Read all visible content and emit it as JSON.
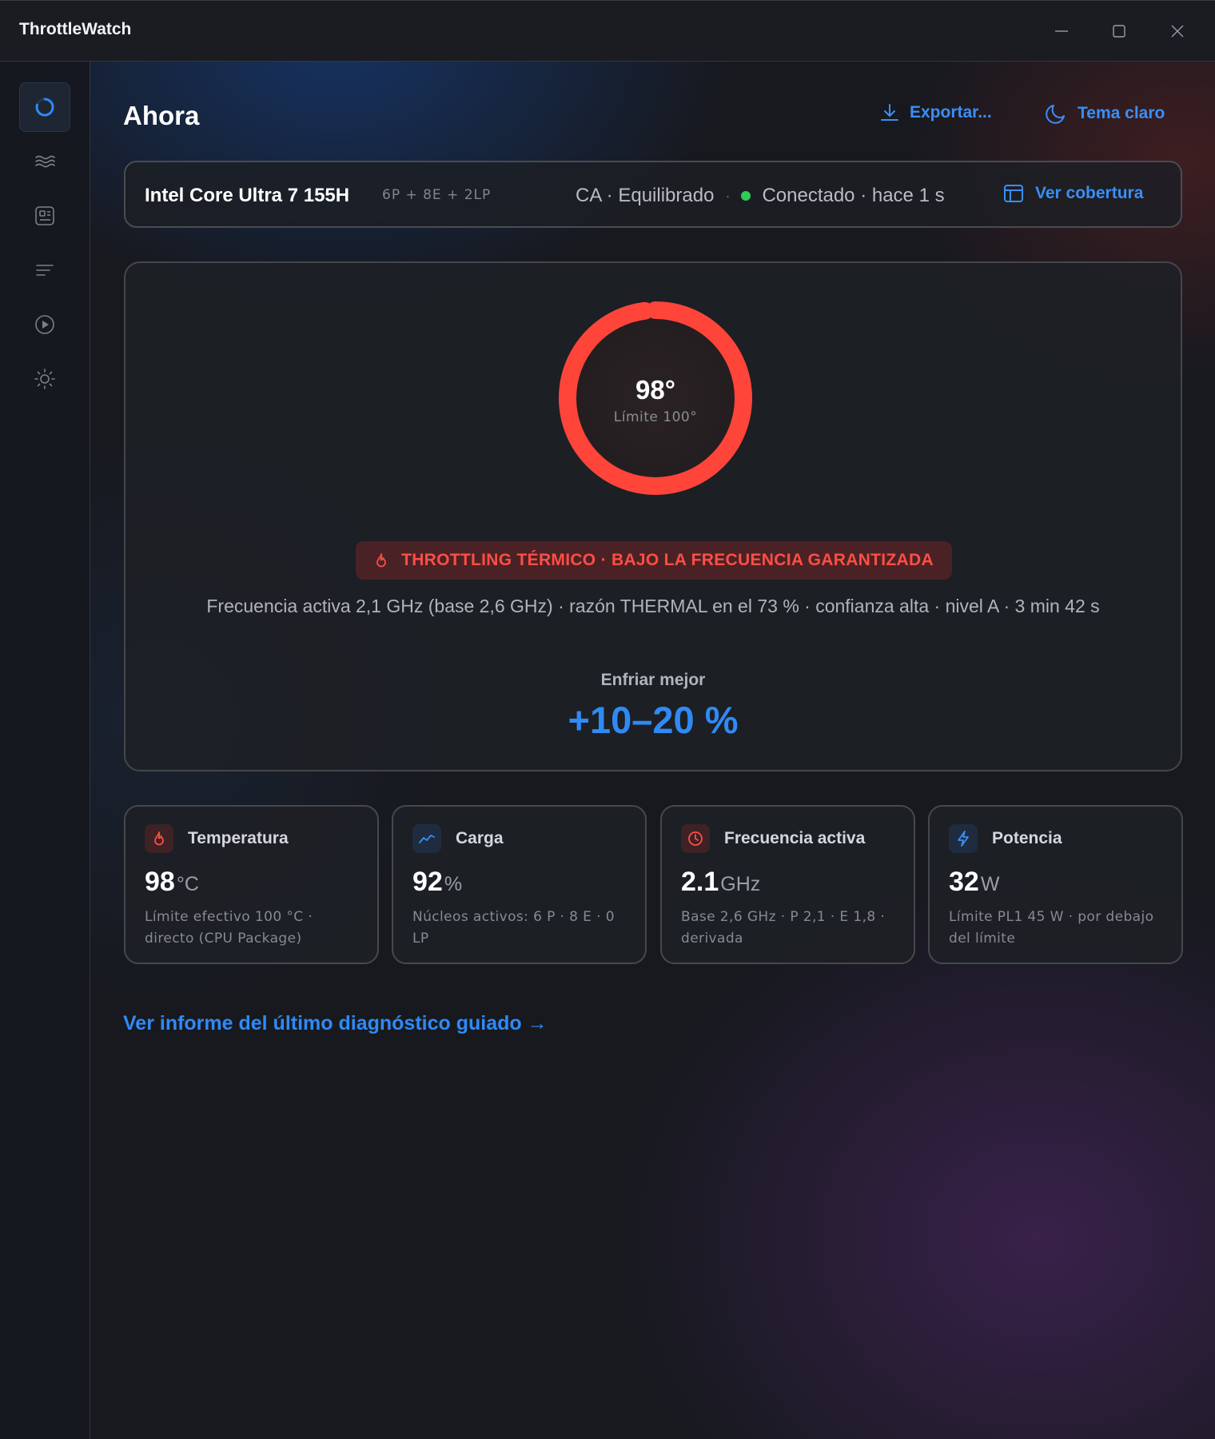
{
  "app": {
    "title": "ThrottleWatch"
  },
  "sidebar": {
    "items": [
      {
        "icon": "activity-ring-icon",
        "active": true
      },
      {
        "icon": "waves-icon",
        "active": false
      },
      {
        "icon": "dashboard-icon",
        "active": false
      },
      {
        "icon": "list-icon",
        "active": false
      },
      {
        "icon": "play-circle-icon",
        "active": false
      },
      {
        "icon": "settings-sun-icon",
        "active": false
      }
    ]
  },
  "header": {
    "title": "Ahora",
    "export_label": "Exportar...",
    "theme_label": "Tema claro"
  },
  "cpu": {
    "name": "Intel Core Ultra 7 155H",
    "cores": "6P + 8E + 2LP",
    "power_profile": "CA · Equilibrado",
    "separator": "·",
    "connection": "Conectado · hace 1 s",
    "coverage_label": "Ver cobertura"
  },
  "hero": {
    "gauge_value": "98°",
    "gauge_limit": "Límite 100°",
    "gauge_fraction": 0.98,
    "status_badge": "THROTTLING TÉRMICO · BAJO LA FRECUENCIA GARANTIZADA",
    "detail": "Frecuencia activa 2,1 GHz (base 2,6 GHz) · razón THERMAL en el 73 % · confianza alta · nivel A · 3 min 42 s",
    "cooling_label": "Enfriar mejor",
    "cooling_value": "+10–20 %"
  },
  "cards": [
    {
      "title": "Temperatura",
      "value": "98",
      "unit": "°C",
      "desc": "Límite efectivo 100 °C · directo (CPU Package)",
      "icon": "flame-icon"
    },
    {
      "title": "Carga",
      "value": "92",
      "unit": "%",
      "desc": "Núcleos activos: 6 P · 8 E · 0 LP",
      "icon": "trend-icon"
    },
    {
      "title": "Frecuencia activa",
      "value": "2.1",
      "unit": "GHz",
      "desc": "Base 2,6 GHz · P 2,1 · E 1,8 · derivada",
      "icon": "clock-icon"
    },
    {
      "title": "Potencia",
      "value": "32",
      "unit": "W",
      "desc": "Límite PL1 45 W · por debajo del límite",
      "icon": "bolt-icon"
    }
  ],
  "report_link": "Ver informe del último diagnóstico guiado →",
  "colors": {
    "accent": "#2f8af5",
    "danger": "#ff453a",
    "success": "#2ecc57"
  }
}
